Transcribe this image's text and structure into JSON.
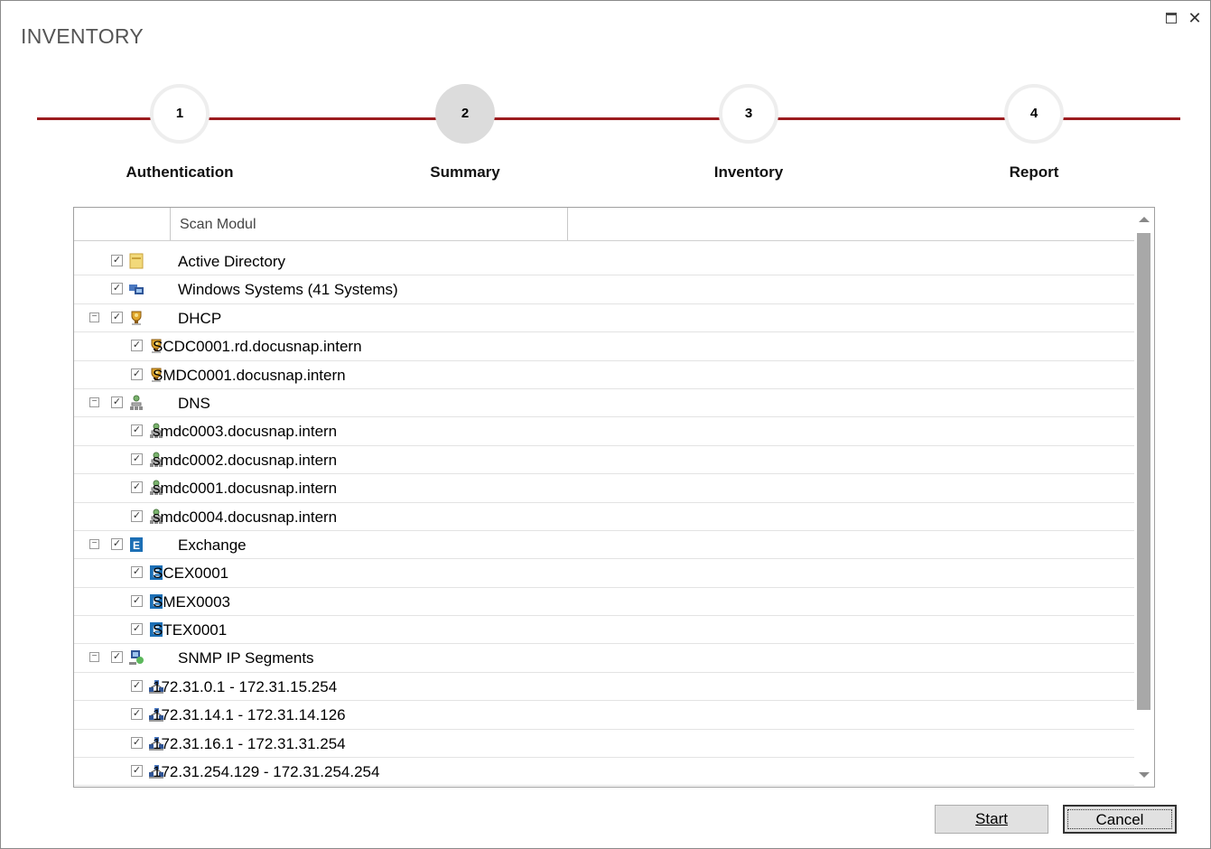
{
  "window": {
    "title": "INVENTORY"
  },
  "steps": [
    {
      "number": "1",
      "label": "Authentication",
      "active": false
    },
    {
      "number": "2",
      "label": "Summary",
      "active": true
    },
    {
      "number": "3",
      "label": "Inventory",
      "active": false
    },
    {
      "number": "4",
      "label": "Report",
      "active": false
    }
  ],
  "grid": {
    "column_header": "Scan Modul",
    "rows": [
      {
        "level": 0,
        "expandable": false,
        "icon": "active-directory-icon",
        "label": "Active Directory"
      },
      {
        "level": 0,
        "expandable": false,
        "icon": "windows-systems-icon",
        "label": "Windows Systems (41 Systems)"
      },
      {
        "level": 0,
        "expandable": true,
        "icon": "dhcp-icon",
        "label": "DHCP"
      },
      {
        "level": 1,
        "expandable": false,
        "icon": "dhcp-icon",
        "label": "SCDC0001.rd.docusnap.intern"
      },
      {
        "level": 1,
        "expandable": false,
        "icon": "dhcp-icon",
        "label": "SMDC0001.docusnap.intern"
      },
      {
        "level": 0,
        "expandable": true,
        "icon": "dns-icon",
        "label": "DNS"
      },
      {
        "level": 1,
        "expandable": false,
        "icon": "dns-icon",
        "label": "smdc0003.docusnap.intern"
      },
      {
        "level": 1,
        "expandable": false,
        "icon": "dns-icon",
        "label": "smdc0002.docusnap.intern"
      },
      {
        "level": 1,
        "expandable": false,
        "icon": "dns-icon",
        "label": "smdc0001.docusnap.intern"
      },
      {
        "level": 1,
        "expandable": false,
        "icon": "dns-icon",
        "label": "smdc0004.docusnap.intern"
      },
      {
        "level": 0,
        "expandable": true,
        "icon": "exchange-icon",
        "label": "Exchange"
      },
      {
        "level": 1,
        "expandable": false,
        "icon": "exchange-icon",
        "label": "SCEX0001"
      },
      {
        "level": 1,
        "expandable": false,
        "icon": "exchange-icon",
        "label": "SMEX0003"
      },
      {
        "level": 1,
        "expandable": false,
        "icon": "exchange-icon",
        "label": "STEX0001"
      },
      {
        "level": 0,
        "expandable": true,
        "icon": "snmp-icon",
        "label": "SNMP IP Segments"
      },
      {
        "level": 1,
        "expandable": false,
        "icon": "ip-segment-icon",
        "label": "172.31.0.1 - 172.31.15.254"
      },
      {
        "level": 1,
        "expandable": false,
        "icon": "ip-segment-icon",
        "label": "172.31.14.1 - 172.31.14.126"
      },
      {
        "level": 1,
        "expandable": false,
        "icon": "ip-segment-icon",
        "label": "172.31.16.1 - 172.31.31.254"
      },
      {
        "level": 1,
        "expandable": false,
        "icon": "ip-segment-icon",
        "label": "172.31.254.129 - 172.31.254.254"
      }
    ]
  },
  "buttons": {
    "start": "Start",
    "cancel": "Cancel"
  },
  "colors": {
    "accent": "#9b1c1f",
    "active_step": "#dcdcdc"
  }
}
